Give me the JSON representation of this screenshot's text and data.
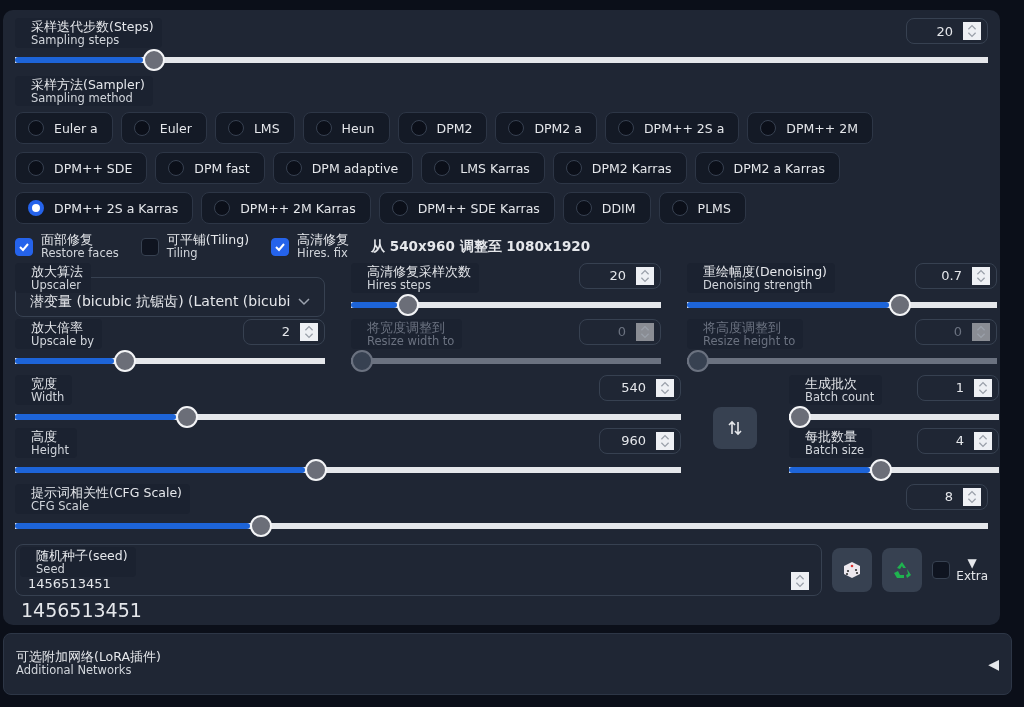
{
  "steps": {
    "label": "采样迭代步数(Steps)",
    "sublabel": "Sampling steps",
    "value": "20",
    "level": 0.135,
    "disabled": false
  },
  "sampler": {
    "label": "采样方法(Sampler)",
    "sublabel": "Sampling method",
    "options": [
      {
        "label": "Euler a",
        "selected": false
      },
      {
        "label": "Euler",
        "selected": false
      },
      {
        "label": "LMS",
        "selected": false
      },
      {
        "label": "Heun",
        "selected": false
      },
      {
        "label": "DPM2",
        "selected": false
      },
      {
        "label": "DPM2 a",
        "selected": false
      },
      {
        "label": "DPM++ 2S a",
        "selected": false
      },
      {
        "label": "DPM++ 2M",
        "selected": false
      },
      {
        "label": "DPM++ SDE",
        "selected": false
      },
      {
        "label": "DPM fast",
        "selected": false
      },
      {
        "label": "DPM adaptive",
        "selected": false
      },
      {
        "label": "LMS Karras",
        "selected": false
      },
      {
        "label": "DPM2 Karras",
        "selected": false
      },
      {
        "label": "DPM2 a Karras",
        "selected": false
      },
      {
        "label": "DPM++ 2S a Karras",
        "selected": true
      },
      {
        "label": "DPM++ 2M Karras",
        "selected": false
      },
      {
        "label": "DPM++ SDE Karras",
        "selected": false
      },
      {
        "label": "DDIM",
        "selected": false
      },
      {
        "label": "PLMS",
        "selected": false
      }
    ]
  },
  "options": [
    {
      "label": "面部修复",
      "sublabel": "Restore faces",
      "checked": true
    },
    {
      "label": "可平铺(Tiling)",
      "sublabel": "Tiling",
      "checked": false
    },
    {
      "label": "高清修复",
      "sublabel": "Hires. fix",
      "checked": true
    }
  ],
  "hires_info": "从 540x960 调整至 1080x1920",
  "upscaler": {
    "label": "放大算法",
    "sublabel": "Upscaler",
    "value": "潜变量 (bicubic 抗锯齿) (Latent (bicubi"
  },
  "hires_sliders": [
    {
      "label": "高清修复采样次数",
      "sublabel": "Hires steps",
      "value": "20",
      "level": 0.16,
      "disabled": false
    },
    {
      "label": "重绘幅度(Denoising)",
      "sublabel": "Denoising strength",
      "value": "0.7",
      "level": 0.7,
      "disabled": false
    },
    {
      "label": "放大倍率",
      "sublabel": "Upscale by",
      "value": "2",
      "level": 0.345,
      "disabled": false
    },
    {
      "label": "将宽度调整到",
      "sublabel": "Resize width to",
      "value": "0",
      "level": 0,
      "disabled": true
    },
    {
      "label": "将高度调整到",
      "sublabel": "Resize height to",
      "value": "0",
      "level": 0,
      "disabled": true
    }
  ],
  "size_sliders": [
    {
      "label": "宽度",
      "sublabel": "Width",
      "value": "540",
      "level": 0.25,
      "disabled": false
    },
    {
      "label": "高度",
      "sublabel": "Height",
      "value": "960",
      "level": 0.45,
      "disabled": false
    }
  ],
  "batch_sliders": [
    {
      "label": "生成批次",
      "sublabel": "Batch count",
      "value": "1",
      "level": 0,
      "disabled": false
    },
    {
      "label": "每批数量",
      "sublabel": "Batch size",
      "value": "4",
      "level": 0.43,
      "disabled": false
    }
  ],
  "cfg": {
    "label": "提示词相关性(CFG Scale)",
    "sublabel": "CFG Scale",
    "value": "8",
    "level": 0.247,
    "disabled": false
  },
  "seed": {
    "label": "随机种子(seed)",
    "sublabel": "Seed",
    "value": "1456513451",
    "echo": "1456513451",
    "extra_checked": false,
    "extra_arrow": "▼",
    "extra_label": "Extra"
  },
  "accordion": {
    "label": "可选附加网络(LoRA插件)",
    "sublabel": "Additional Networks",
    "arrow": "◀"
  }
}
